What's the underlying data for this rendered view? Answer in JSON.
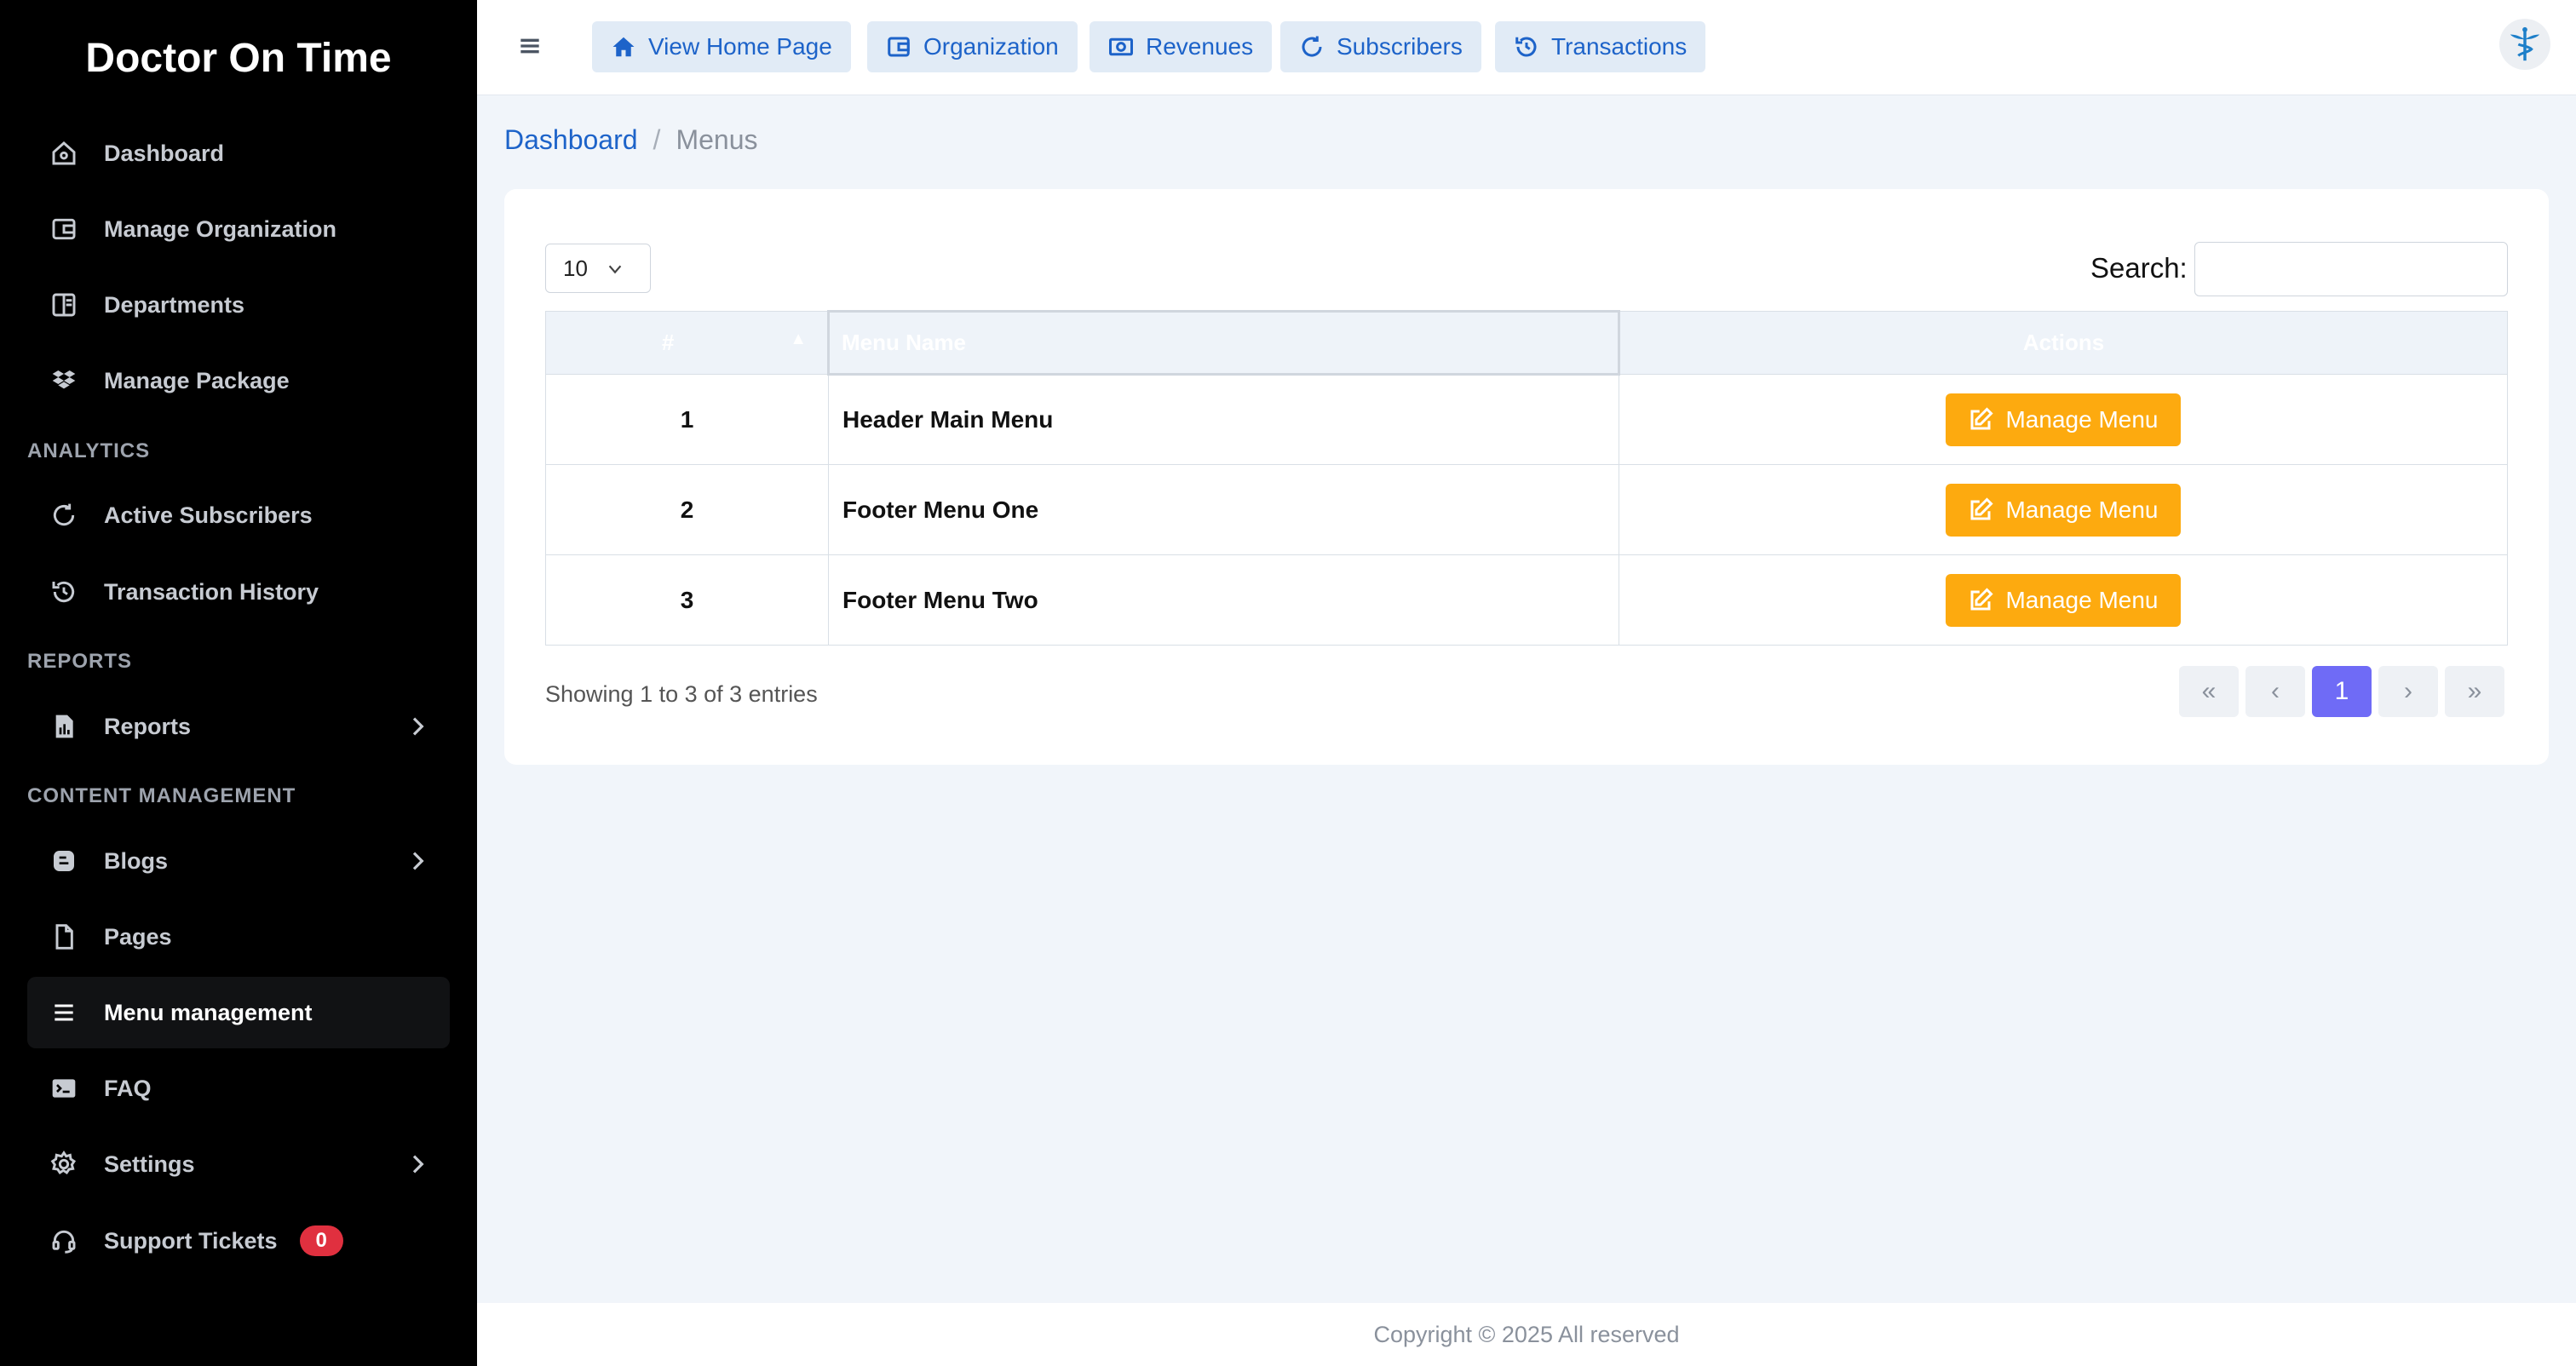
{
  "sidebar": {
    "brand": "Doctor On Time",
    "items": [
      {
        "label": "Dashboard",
        "icon": "home-icon"
      },
      {
        "label": "Manage Organization",
        "icon": "wallet-icon"
      },
      {
        "label": "Departments",
        "icon": "columns-icon"
      },
      {
        "label": "Manage Package",
        "icon": "dropbox-icon"
      },
      {
        "label": "Active Subscribers",
        "icon": "refresh-icon"
      },
      {
        "label": "Transaction History",
        "icon": "history-icon"
      },
      {
        "label": "Reports",
        "icon": "report-icon"
      },
      {
        "label": "Blogs",
        "icon": "blog-icon"
      },
      {
        "label": "Pages",
        "icon": "file-icon"
      },
      {
        "label": "Menu management",
        "icon": "menu-icon"
      },
      {
        "label": "FAQ",
        "icon": "terminal-icon"
      },
      {
        "label": "Settings",
        "icon": "gear-icon"
      },
      {
        "label": "Support Tickets",
        "icon": "headset-icon",
        "badge": "0"
      }
    ],
    "sections": {
      "analytics": "ANALYTICS",
      "reports": "REPORTS",
      "content": "CONTENT MANAGEMENT"
    }
  },
  "topbar": {
    "buttons": [
      {
        "label": "View Home Page",
        "icon": "home-icon"
      },
      {
        "label": "Organization",
        "icon": "wallet-icon"
      },
      {
        "label": "Revenues",
        "icon": "money-icon"
      },
      {
        "label": "Subscribers",
        "icon": "refresh-icon"
      },
      {
        "label": "Transactions",
        "icon": "history-icon"
      }
    ]
  },
  "breadcrumb": {
    "home": "Dashboard",
    "separator": "/",
    "current": "Menus"
  },
  "table": {
    "length_value": "10",
    "search_label": "Search:",
    "columns": [
      "#",
      "Menu Name",
      "Actions"
    ],
    "rows": [
      {
        "num": "1",
        "name": "Header Main Menu",
        "action": "Manage Menu"
      },
      {
        "num": "2",
        "name": "Footer Menu One",
        "action": "Manage Menu"
      },
      {
        "num": "3",
        "name": "Footer Menu Two",
        "action": "Manage Menu"
      }
    ],
    "info": "Showing 1 to 3 of 3 entries",
    "pagination": {
      "first": "«",
      "prev": "‹",
      "current": "1",
      "next": "›",
      "last": "»"
    }
  },
  "footer": {
    "text": "Copyright © 2025 All reserved"
  },
  "colors": {
    "accent": "#1d63c9",
    "warning": "#fdaa0f",
    "pager_active": "#6f6bf6",
    "badge": "#e0303f"
  }
}
